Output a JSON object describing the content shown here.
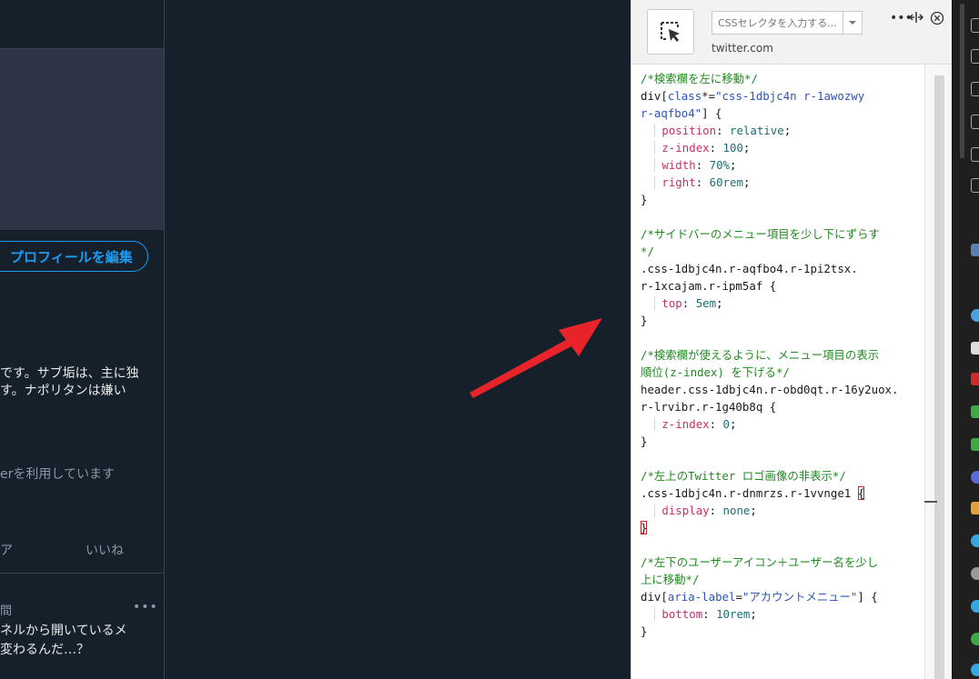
{
  "twitter": {
    "edit_profile_label": "プロフィールを編集",
    "bio_line_1": "です。サブ垢は、主に独",
    "bio_line_2": "す。ナポリタンは嫌い",
    "using_text": "erを利用しています",
    "tab_a": "ア",
    "tab_likes": "いいね",
    "tweet_time": "間",
    "tweet_more": "•••",
    "tweet_line_1": "ネルから開いているメ",
    "tweet_line_2": "変わるんだ…？",
    "tweet_line_3": ""
  },
  "panel": {
    "selector_placeholder": "CSSセレクタを入力する...",
    "site_domain": "twitter.com",
    "more_label": "•••"
  },
  "colors": {
    "twitter_bg": "#15202b",
    "twitter_accent": "#1d9bf0",
    "arrow": "#e8232a",
    "comment": "#1f8a1f",
    "property": "#c4326a",
    "value": "#1c6e73"
  },
  "icons": {
    "picker": "cursor-arrow-icon",
    "dropdown": "chevron-down-icon",
    "more": "more-dots-icon",
    "resize": "resize-horizontal-icon",
    "close": "close-circle-icon"
  },
  "code": {
    "comment_1": "/*検索欄を左に移動*/",
    "sel_1_tag": "div",
    "sel_1_attr": "class",
    "sel_1_op": "*=",
    "sel_1_str_a": "\"css-1dbjc4n r-1awozwy",
    "sel_1_str_b": "r-aqfbo4\"",
    "p1_1": "position",
    "v1_1": "relative",
    "p1_2": "z-index",
    "v1_2": "100",
    "p1_3": "width",
    "v1_3": "70%",
    "p1_4": "right",
    "v1_4": "60rem",
    "comment_2a": "/*サイドバーのメニュー項目を少し下にずらす",
    "comment_2b": "*/",
    "sel_2a": ".css-1dbjc4n.r-aqfbo4.r-1pi2tsx.",
    "sel_2b": "r-1xcajam.r-ipm5af",
    "p2_1": "top",
    "v2_1": "5em",
    "comment_3a": "/*検索欄が使えるように、メニュー項目の表示",
    "comment_3b": "順位(z-index) を下げる*/",
    "sel_3a": "header.css-1dbjc4n.r-obd0qt.r-16y2uox.",
    "sel_3b": "r-lrvibr.r-1g40b8q",
    "p3_1": "z-index",
    "v3_1": "0",
    "comment_4": "/*左上のTwitter ロゴ画像の非表示*/",
    "sel_4": ".css-1dbjc4n.r-dnmrzs.r-1vvnge1",
    "p4_1": "display",
    "v4_1": "none",
    "comment_5a": "/*左下のユーザーアイコン＋ユーザー名を少し",
    "comment_5b": "上に移動*/",
    "sel_5_tag": "div",
    "sel_5_attr": "aria-label",
    "sel_5_op": "=",
    "sel_5_str": "\"アカウントメニュー\"",
    "p5_1": "bottom",
    "v5_1": "10rem"
  }
}
